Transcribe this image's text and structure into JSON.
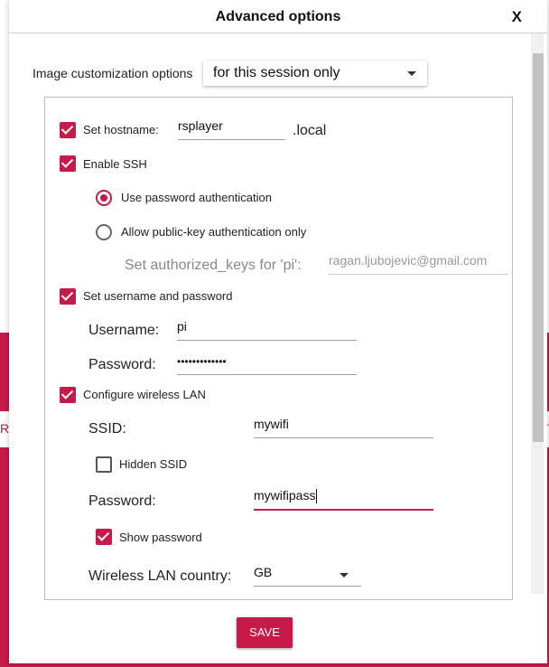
{
  "background": {
    "left_fragment": "RA",
    "right_fragment": "IT",
    "accent_color": "#c51a4a"
  },
  "dialog": {
    "title": "Advanced options",
    "close_label": "X"
  },
  "customization": {
    "label": "Image customization options",
    "selected": "for this session only"
  },
  "hostname": {
    "checkbox_label": "Set hostname:",
    "checked": true,
    "value": "rsplayer",
    "suffix": ".local"
  },
  "ssh": {
    "checkbox_label": "Enable SSH",
    "checked": true,
    "radio_password": "Use password authentication",
    "radio_pubkey": "Allow public-key authentication only",
    "selected": "password",
    "authorized_keys_label": "Set authorized_keys for 'pi':",
    "authorized_keys_value": "ragan.ljubojevic@gmail.com"
  },
  "user": {
    "checkbox_label": "Set username and password",
    "checked": true,
    "username_label": "Username:",
    "username_value": "pi",
    "password_label": "Password:",
    "password_value": "•••••••••••••"
  },
  "wifi": {
    "checkbox_label": "Configure wireless LAN",
    "checked": true,
    "ssid_label": "SSID:",
    "ssid_value": "mywifi",
    "hidden_ssid_label": "Hidden SSID",
    "hidden_ssid_checked": false,
    "password_label": "Password:",
    "password_value": "mywifipass",
    "show_password_label": "Show password",
    "show_password_checked": true,
    "country_label": "Wireless LAN country:",
    "country_value": "GB"
  },
  "footer": {
    "save_label": "SAVE"
  }
}
